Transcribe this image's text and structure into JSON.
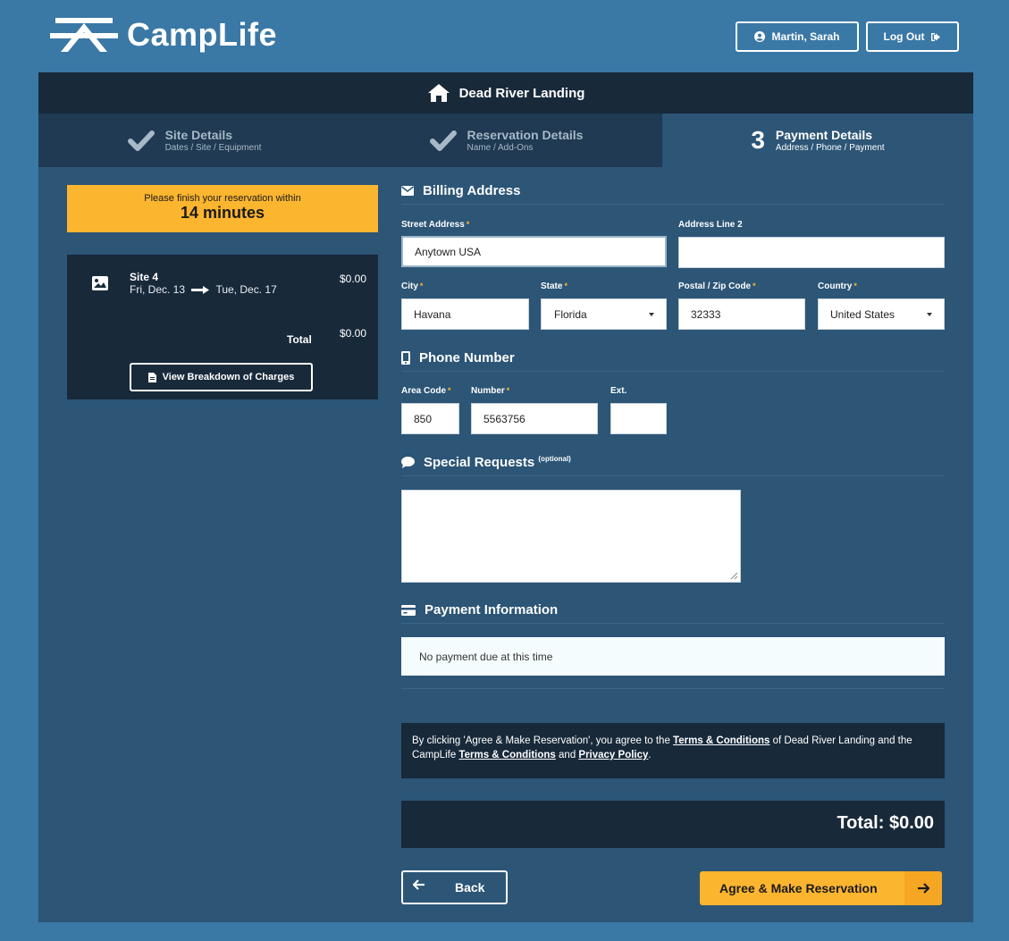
{
  "app": {
    "name": "CampLife"
  },
  "header": {
    "user_name": "Martin, Sarah",
    "logout_label": "Log Out"
  },
  "park": {
    "name": "Dead River Landing"
  },
  "steps": [
    {
      "title": "Site Details",
      "subtitle": "Dates / Site / Equipment",
      "status": "complete"
    },
    {
      "title": "Reservation Details",
      "subtitle": "Name / Add-Ons",
      "status": "complete"
    },
    {
      "number": "3",
      "title": "Payment Details",
      "subtitle": "Address / Phone / Payment",
      "status": "current"
    }
  ],
  "timer": {
    "label": "Please finish your reservation within",
    "value": "14 minutes"
  },
  "summary": {
    "site": "Site 4",
    "date_from": "Fri, Dec. 13",
    "date_to": "Tue, Dec. 17",
    "site_price": "$0.00",
    "total_label": "Total",
    "total_value": "$0.00",
    "breakdown_button": "View Breakdown of Charges"
  },
  "billing": {
    "title": "Billing Address",
    "street_label": "Street Address",
    "street_value": "Anytown USA",
    "address2_label": "Address Line 2",
    "address2_value": "",
    "city_label": "City",
    "city_value": "Havana",
    "state_label": "State",
    "state_value": "Florida",
    "zip_label": "Postal / Zip Code",
    "zip_value": "32333",
    "country_label": "Country",
    "country_value": "United States"
  },
  "phone": {
    "title": "Phone Number",
    "area_label": "Area Code",
    "area_value": "850",
    "number_label": "Number",
    "number_value": "5563756",
    "ext_label": "Ext.",
    "ext_value": ""
  },
  "special": {
    "title": "Special Requests",
    "optional": "(optional)",
    "value": ""
  },
  "payment": {
    "title": "Payment Information",
    "message": "No payment due at this time"
  },
  "terms": {
    "part1": "By clicking 'Agree & Make Reservation', you agree to the ",
    "link1": "Terms & Conditions",
    "part2": " of Dead River Landing and the CampLife ",
    "link2": "Terms & Conditions",
    "part3": " and ",
    "link3": "Privacy Policy",
    "part4": "."
  },
  "total": {
    "text": "Total: $0.00"
  },
  "buttons": {
    "back": "Back",
    "agree": "Agree & Make Reservation"
  },
  "colors": {
    "accent": "#fcb52f",
    "page_bg": "#3a78a6",
    "panel_bg": "#2c5576",
    "dark": "#18293a"
  }
}
